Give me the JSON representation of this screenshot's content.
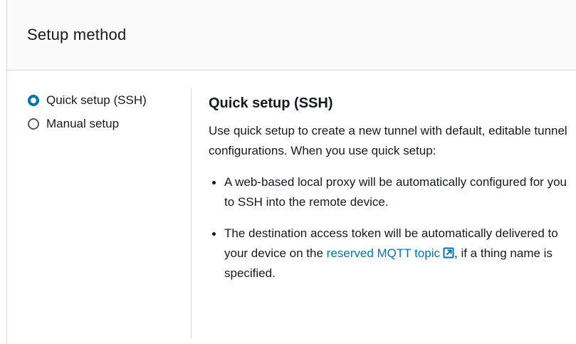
{
  "panel": {
    "title": "Setup method"
  },
  "options": [
    {
      "label": "Quick setup (SSH)",
      "selected": true
    },
    {
      "label": "Manual setup",
      "selected": false
    }
  ],
  "content": {
    "heading": "Quick setup (SSH)",
    "intro": "Use quick setup to create a new tunnel with default, editable tunnel configurations. When you use quick setup:",
    "bullet1": "A web-based local proxy will be automatically configured for you to SSH into the remote device.",
    "bullet2_before": "The destination access token will be automatically delivered to your device on the ",
    "bullet2_link": "reserved MQTT topic",
    "bullet2_after": ", if a thing name is specified."
  },
  "colors": {
    "accent": "#0073bb",
    "text": "#16191f",
    "border": "#d5dbdb",
    "header_bg": "#fafafa"
  },
  "icons": {
    "external_link": "external-link-icon"
  }
}
